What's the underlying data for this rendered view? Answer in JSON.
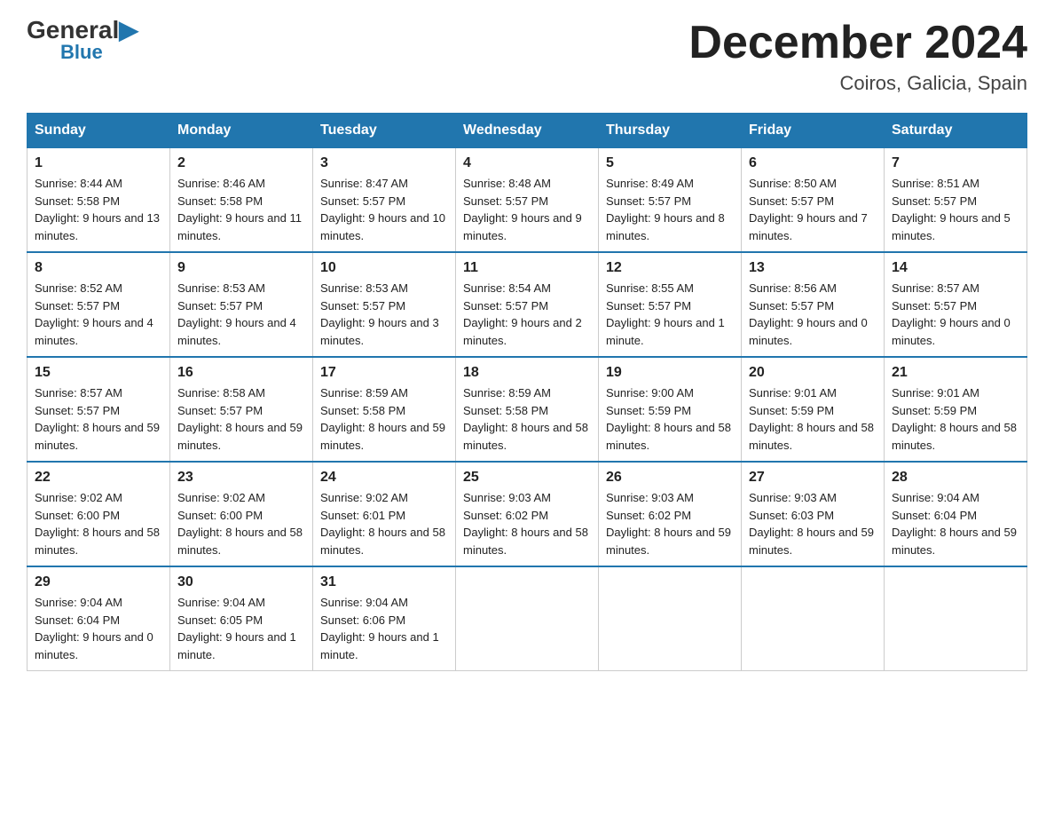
{
  "header": {
    "logo_general": "General",
    "logo_blue": "Blue",
    "title": "December 2024",
    "location": "Coiros, Galicia, Spain"
  },
  "days_of_week": [
    "Sunday",
    "Monday",
    "Tuesday",
    "Wednesday",
    "Thursday",
    "Friday",
    "Saturday"
  ],
  "weeks": [
    [
      {
        "day": "1",
        "sunrise": "8:44 AM",
        "sunset": "5:58 PM",
        "daylight": "9 hours and 13 minutes."
      },
      {
        "day": "2",
        "sunrise": "8:46 AM",
        "sunset": "5:58 PM",
        "daylight": "9 hours and 11 minutes."
      },
      {
        "day": "3",
        "sunrise": "8:47 AM",
        "sunset": "5:57 PM",
        "daylight": "9 hours and 10 minutes."
      },
      {
        "day": "4",
        "sunrise": "8:48 AM",
        "sunset": "5:57 PM",
        "daylight": "9 hours and 9 minutes."
      },
      {
        "day": "5",
        "sunrise": "8:49 AM",
        "sunset": "5:57 PM",
        "daylight": "9 hours and 8 minutes."
      },
      {
        "day": "6",
        "sunrise": "8:50 AM",
        "sunset": "5:57 PM",
        "daylight": "9 hours and 7 minutes."
      },
      {
        "day": "7",
        "sunrise": "8:51 AM",
        "sunset": "5:57 PM",
        "daylight": "9 hours and 5 minutes."
      }
    ],
    [
      {
        "day": "8",
        "sunrise": "8:52 AM",
        "sunset": "5:57 PM",
        "daylight": "9 hours and 4 minutes."
      },
      {
        "day": "9",
        "sunrise": "8:53 AM",
        "sunset": "5:57 PM",
        "daylight": "9 hours and 4 minutes."
      },
      {
        "day": "10",
        "sunrise": "8:53 AM",
        "sunset": "5:57 PM",
        "daylight": "9 hours and 3 minutes."
      },
      {
        "day": "11",
        "sunrise": "8:54 AM",
        "sunset": "5:57 PM",
        "daylight": "9 hours and 2 minutes."
      },
      {
        "day": "12",
        "sunrise": "8:55 AM",
        "sunset": "5:57 PM",
        "daylight": "9 hours and 1 minute."
      },
      {
        "day": "13",
        "sunrise": "8:56 AM",
        "sunset": "5:57 PM",
        "daylight": "9 hours and 0 minutes."
      },
      {
        "day": "14",
        "sunrise": "8:57 AM",
        "sunset": "5:57 PM",
        "daylight": "9 hours and 0 minutes."
      }
    ],
    [
      {
        "day": "15",
        "sunrise": "8:57 AM",
        "sunset": "5:57 PM",
        "daylight": "8 hours and 59 minutes."
      },
      {
        "day": "16",
        "sunrise": "8:58 AM",
        "sunset": "5:57 PM",
        "daylight": "8 hours and 59 minutes."
      },
      {
        "day": "17",
        "sunrise": "8:59 AM",
        "sunset": "5:58 PM",
        "daylight": "8 hours and 59 minutes."
      },
      {
        "day": "18",
        "sunrise": "8:59 AM",
        "sunset": "5:58 PM",
        "daylight": "8 hours and 58 minutes."
      },
      {
        "day": "19",
        "sunrise": "9:00 AM",
        "sunset": "5:59 PM",
        "daylight": "8 hours and 58 minutes."
      },
      {
        "day": "20",
        "sunrise": "9:01 AM",
        "sunset": "5:59 PM",
        "daylight": "8 hours and 58 minutes."
      },
      {
        "day": "21",
        "sunrise": "9:01 AM",
        "sunset": "5:59 PM",
        "daylight": "8 hours and 58 minutes."
      }
    ],
    [
      {
        "day": "22",
        "sunrise": "9:02 AM",
        "sunset": "6:00 PM",
        "daylight": "8 hours and 58 minutes."
      },
      {
        "day": "23",
        "sunrise": "9:02 AM",
        "sunset": "6:00 PM",
        "daylight": "8 hours and 58 minutes."
      },
      {
        "day": "24",
        "sunrise": "9:02 AM",
        "sunset": "6:01 PM",
        "daylight": "8 hours and 58 minutes."
      },
      {
        "day": "25",
        "sunrise": "9:03 AM",
        "sunset": "6:02 PM",
        "daylight": "8 hours and 58 minutes."
      },
      {
        "day": "26",
        "sunrise": "9:03 AM",
        "sunset": "6:02 PM",
        "daylight": "8 hours and 59 minutes."
      },
      {
        "day": "27",
        "sunrise": "9:03 AM",
        "sunset": "6:03 PM",
        "daylight": "8 hours and 59 minutes."
      },
      {
        "day": "28",
        "sunrise": "9:04 AM",
        "sunset": "6:04 PM",
        "daylight": "8 hours and 59 minutes."
      }
    ],
    [
      {
        "day": "29",
        "sunrise": "9:04 AM",
        "sunset": "6:04 PM",
        "daylight": "9 hours and 0 minutes."
      },
      {
        "day": "30",
        "sunrise": "9:04 AM",
        "sunset": "6:05 PM",
        "daylight": "9 hours and 1 minute."
      },
      {
        "day": "31",
        "sunrise": "9:04 AM",
        "sunset": "6:06 PM",
        "daylight": "9 hours and 1 minute."
      },
      null,
      null,
      null,
      null
    ]
  ]
}
